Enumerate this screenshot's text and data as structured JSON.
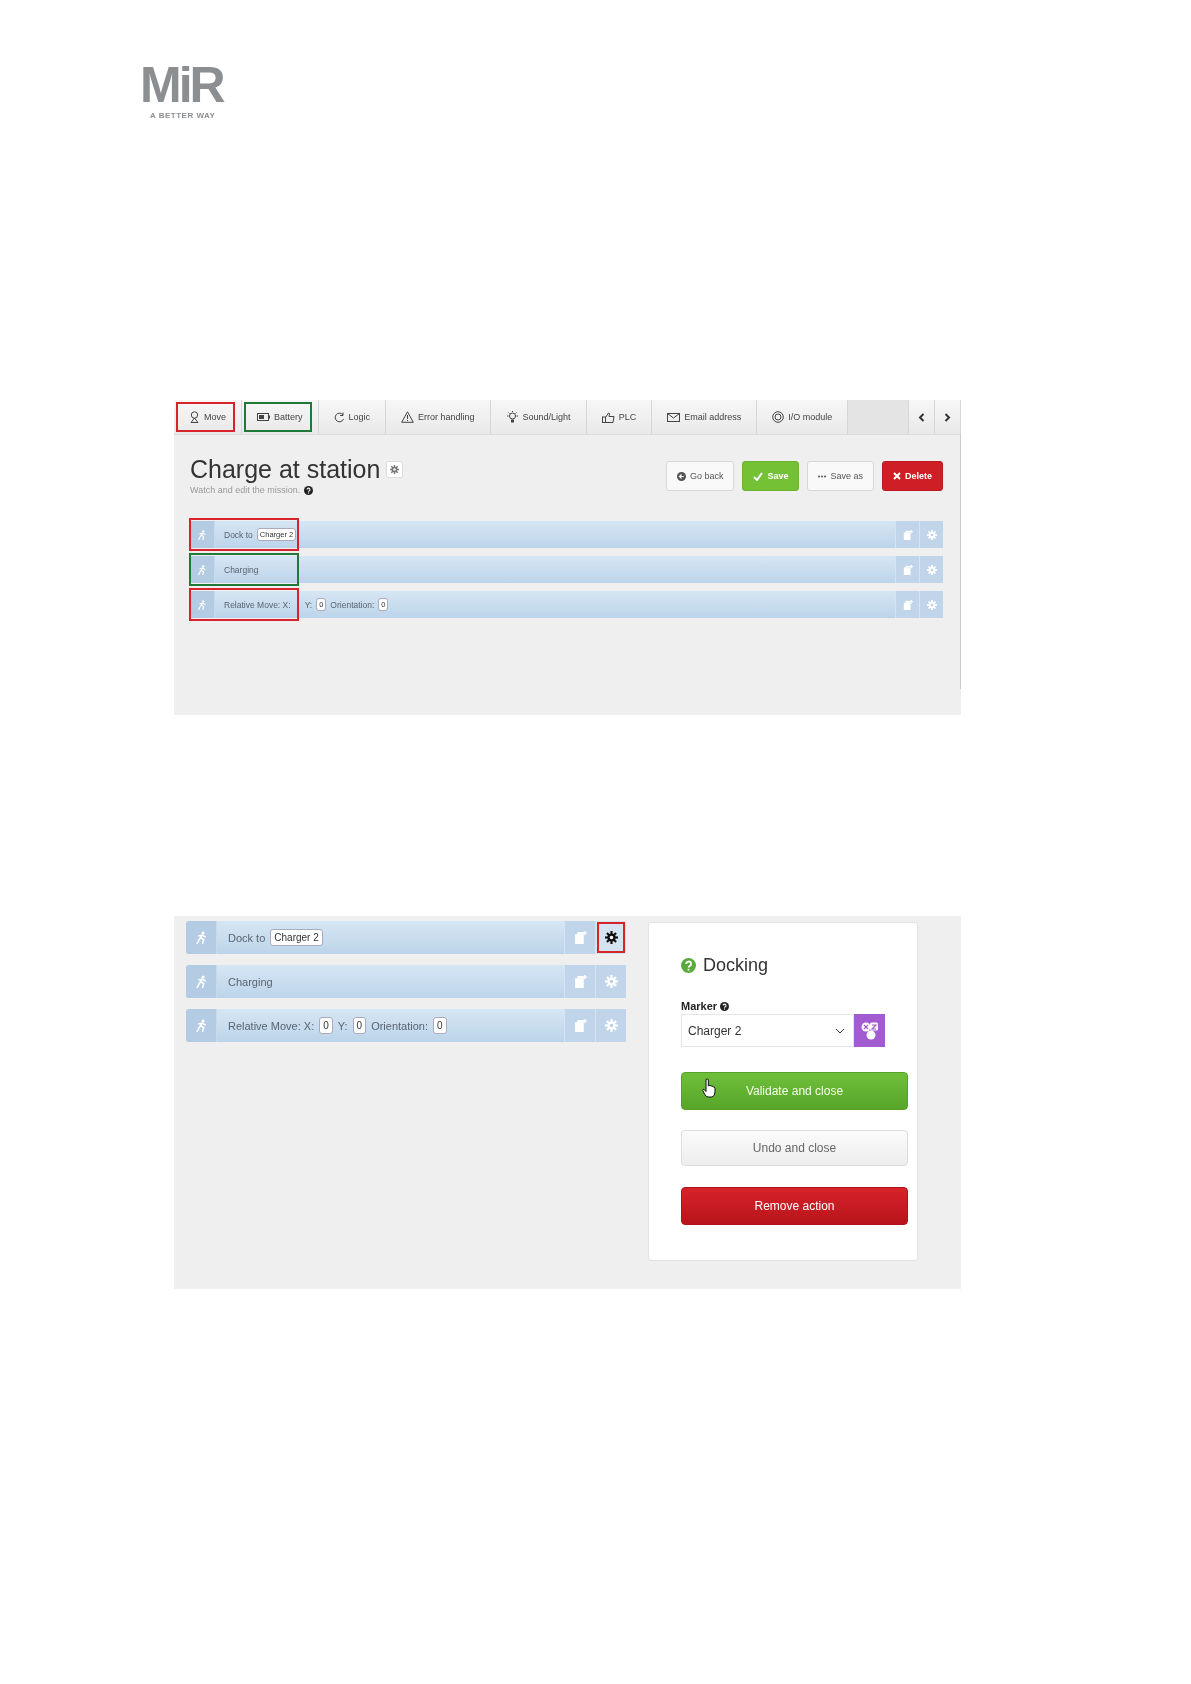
{
  "logo": {
    "name": "MiR",
    "tagline": "A BETTER WAY"
  },
  "mission_editor": {
    "tabs": [
      {
        "kind": "move",
        "label": "Move",
        "color": "#d8232a"
      },
      {
        "kind": "battery",
        "label": "Battery",
        "color": "#1f7a3a"
      },
      {
        "kind": "logic",
        "label": "Logic"
      },
      {
        "kind": "error",
        "label": "Error handling"
      },
      {
        "kind": "sound",
        "label": "Sound/Light"
      },
      {
        "kind": "plc",
        "label": "PLC"
      },
      {
        "kind": "email",
        "label": "Email address"
      },
      {
        "kind": "io",
        "label": "I/O module"
      }
    ],
    "title": "Charge at station",
    "subtitle": "Watch and edit the mission.",
    "buttons": [
      {
        "kind": "back",
        "label": "Go back"
      },
      {
        "kind": "save",
        "label": "Save"
      },
      {
        "kind": "save_as",
        "label": "Save as"
      },
      {
        "kind": "delete",
        "label": "Delete"
      }
    ],
    "actions": [
      {
        "color": "#d8232a",
        "parts": [
          {
            "kind": "text",
            "text": "Dock to"
          },
          {
            "kind": "value",
            "text": "Charger 2"
          }
        ]
      },
      {
        "color": "#1f7a3a",
        "parts": [
          {
            "kind": "text",
            "text": "Charging"
          }
        ]
      },
      {
        "color": "#d8232a",
        "parts": [
          {
            "kind": "text",
            "text": "Relative Move: X:"
          },
          {
            "kind": "text",
            "text": "Y:"
          },
          {
            "kind": "value",
            "text": "0"
          },
          {
            "kind": "text",
            "text": "Orientation:"
          },
          {
            "kind": "value",
            "text": "0"
          }
        ]
      }
    ]
  },
  "action_settings": {
    "actions": [
      {
        "settings_open": true,
        "color": "#d8232a",
        "parts": [
          {
            "kind": "text",
            "text": "Dock to"
          },
          {
            "kind": "value",
            "text": "Charger 2"
          }
        ]
      },
      {
        "settings_open": false,
        "parts": [
          {
            "kind": "text",
            "text": "Charging"
          }
        ]
      },
      {
        "settings_open": false,
        "parts": [
          {
            "kind": "text",
            "text": "Relative Move: X:"
          },
          {
            "kind": "value",
            "text": "0"
          },
          {
            "kind": "text",
            "text": "Y:"
          },
          {
            "kind": "value",
            "text": "0"
          },
          {
            "kind": "text",
            "text": "Orientation:"
          },
          {
            "kind": "value",
            "text": "0"
          }
        ]
      }
    ],
    "panel": {
      "title": "Docking",
      "field_label": "Marker",
      "field_value": "Charger 2",
      "buttons": [
        {
          "kind": "validate",
          "label": "Validate and close"
        },
        {
          "kind": "undo",
          "label": "Undo and close"
        },
        {
          "kind": "remove",
          "label": "Remove action"
        }
      ]
    }
  }
}
